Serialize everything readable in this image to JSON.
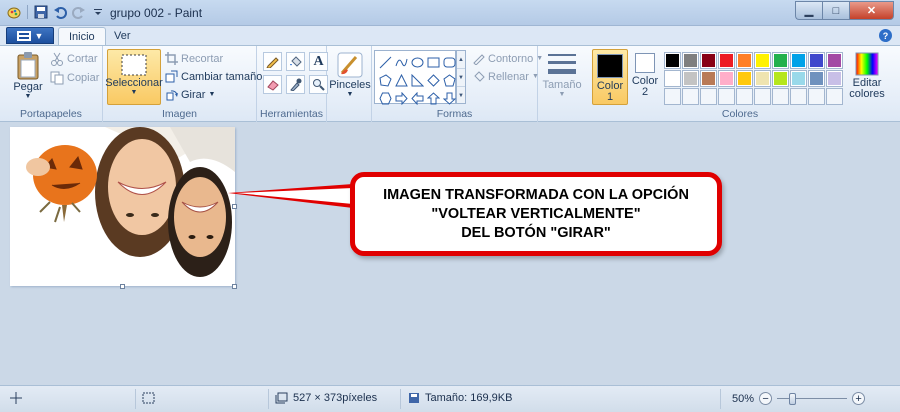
{
  "window": {
    "title": "grupo 002 - Paint",
    "minimize_icon": "minimize-icon",
    "maximize_icon": "maximize-icon",
    "close_icon": "close-icon"
  },
  "quick_access": [
    "paint-app-icon",
    "save-icon",
    "undo-icon",
    "redo-icon",
    "customize-dropdown-icon"
  ],
  "tabs": [
    {
      "label": "Inicio",
      "active": true
    },
    {
      "label": "Ver",
      "active": false
    }
  ],
  "ribbon": {
    "portapapeles": {
      "label": "Portapapeles",
      "paste": "Pegar",
      "cut": "Cortar",
      "copy": "Copiar"
    },
    "imagen": {
      "label": "Imagen",
      "select": "Seleccionar",
      "crop": "Recortar",
      "resize": "Cambiar tamaño",
      "rotate": "Girar"
    },
    "herramientas": {
      "label": "Herramientas"
    },
    "pinceles": {
      "label": "Pinceles"
    },
    "formas": {
      "label": "Formas",
      "outline": "Contorno",
      "fill": "Rellenar"
    },
    "tamano": {
      "label": "Tamaño"
    },
    "colores": {
      "label": "Colores",
      "color1": "Color 1",
      "color2": "Color 2",
      "edit": "Editar colores",
      "color1_value": "#000000",
      "color2_value": "#ffffff",
      "palette_row1": [
        "#000000",
        "#7f7f7f",
        "#880015",
        "#ed1c24",
        "#ff7f27",
        "#fff200",
        "#22b14c",
        "#00a2e8",
        "#3f48cc",
        "#a349a4"
      ],
      "palette_row2": [
        "#ffffff",
        "#c3c3c3",
        "#b97a57",
        "#ffaec9",
        "#ffc90e",
        "#efe4b0",
        "#b5e61d",
        "#99d9ea",
        "#7092be",
        "#c8bfe7"
      ]
    }
  },
  "callout": {
    "line1": "IMAGEN TRANSFORMADA CON LA OPCIÓN",
    "line2": "\"VOLTEAR VERTICALMENTE\"",
    "line3": "DEL BOTÓN \"GIRAR\""
  },
  "status": {
    "dimensions": "527 × 373píxeles",
    "size": "Tamaño: 169,9KB",
    "zoom": "50%"
  },
  "colors": {
    "accent": "#1d4f9e",
    "callout_border": "#e00000"
  }
}
